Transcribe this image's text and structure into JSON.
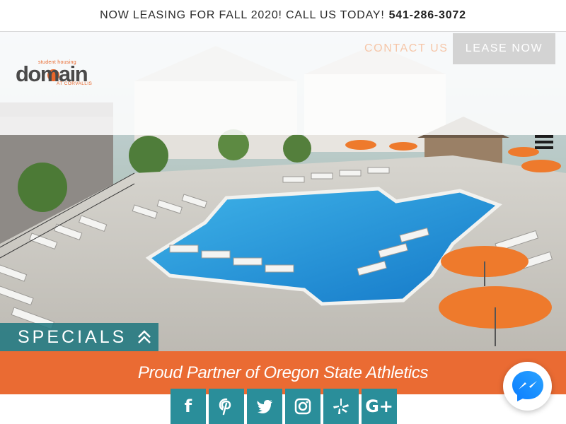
{
  "announcement": {
    "text": "NOW LEASING FOR FALL 2020! CALL US TODAY!",
    "phone": "541-286-3072"
  },
  "logo": {
    "tagline": "student housing",
    "name": "domain",
    "location": "AT CORVALLIS"
  },
  "nav": {
    "contact_label": "CONTACT US",
    "lease_label": "LEASE NOW"
  },
  "specials": {
    "label": "SPECIALS"
  },
  "partner": {
    "text": "Proud Partner of Oregon State Athletics"
  },
  "social": [
    {
      "name": "facebook-icon",
      "glyph": "f"
    },
    {
      "name": "pinterest-icon",
      "glyph": "P"
    },
    {
      "name": "twitter-icon",
      "glyph": ""
    },
    {
      "name": "instagram-icon",
      "glyph": ""
    },
    {
      "name": "yelp-icon",
      "glyph": ""
    },
    {
      "name": "google-plus-icon",
      "glyph": "G+"
    }
  ],
  "colors": {
    "accent_orange": "#ea6b33",
    "teal": "#2a8e9a",
    "specials_teal": "#217880",
    "lease_button": "#d3d3d3"
  }
}
